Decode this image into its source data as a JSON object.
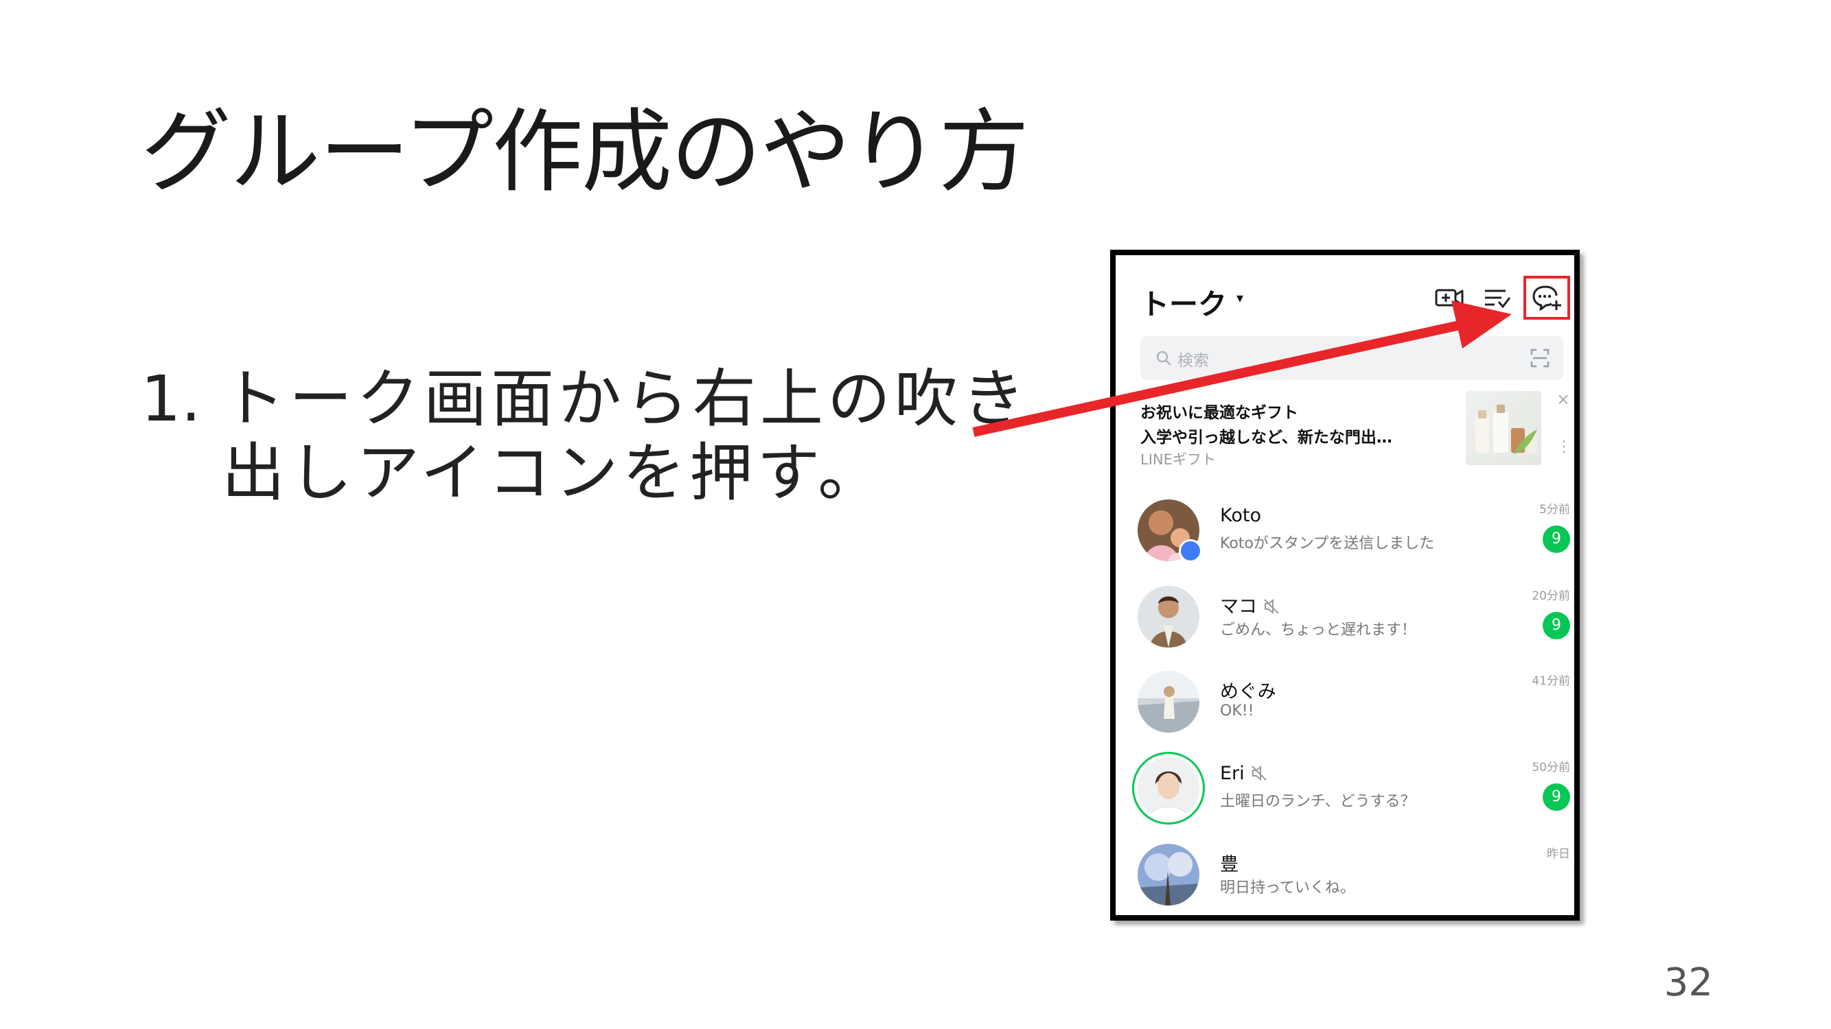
{
  "slide": {
    "title": "グループ作成のやり方",
    "step_number": "1.",
    "step_line1": "トーク画面から右上の吹き",
    "step_line2": "出しアイコンを押す。",
    "page_number": "32"
  },
  "phone": {
    "header": {
      "title": "トーク",
      "caret": "▾"
    },
    "icons": {
      "video": "video-call-add-icon",
      "sort": "sort-filter-icon",
      "compose": "new-chat-bubble-icon"
    },
    "search": {
      "placeholder": "検索"
    },
    "ad": {
      "line1": "お祝いに最適なギフト",
      "line2": "入学や引っ越しなど、新たな門出…",
      "source": "LINEギフト",
      "close": "×",
      "more": "⋮"
    },
    "chats": [
      {
        "name": "Koto",
        "preview": "Kotoがスタンプを送信しました",
        "time": "5分前",
        "badge": "9"
      },
      {
        "name": "マコ",
        "preview": "ごめん、ちょっと遅れます！",
        "time": "20分前",
        "badge": "9"
      },
      {
        "name": "めぐみ",
        "preview": "OK!!",
        "time": "41分前"
      },
      {
        "name": "Eri",
        "preview": "土曜日のランチ、どうする？",
        "time": "50分前",
        "badge": "9"
      },
      {
        "name": "豊",
        "preview": "明日持っていくね。",
        "time": "昨日"
      }
    ]
  },
  "colors": {
    "line_green": "#06c755",
    "highlight_red": "#e8262a",
    "pin_blue": "#3e7bf6"
  }
}
